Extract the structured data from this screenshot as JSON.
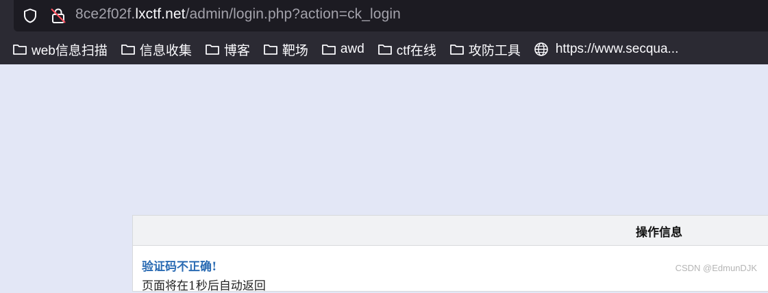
{
  "urlbar": {
    "url_prefix": "8ce2f02f.",
    "url_domain": "lxctf.net",
    "url_path": "/admin/login.php?action=ck_login"
  },
  "bookmarks": [
    {
      "label": "web信息扫描",
      "icon": "folder-icon"
    },
    {
      "label": "信息收集",
      "icon": "folder-icon"
    },
    {
      "label": "博客",
      "icon": "folder-icon"
    },
    {
      "label": "靶场",
      "icon": "folder-icon"
    },
    {
      "label": "awd",
      "icon": "folder-icon"
    },
    {
      "label": "ctf在线",
      "icon": "folder-icon"
    },
    {
      "label": "攻防工具",
      "icon": "folder-icon"
    },
    {
      "label": "https://www.secqua...",
      "icon": "globe-icon"
    }
  ],
  "message": {
    "title": "操作信息",
    "error": "验证码不正确!",
    "redirect": "页面将在1秒后自动返回"
  },
  "watermark": "CSDN @EdmunDJK",
  "colors": {
    "chrome_bg": "#2b2a33",
    "urlbar_bg": "#1c1b22",
    "page_bg": "#e3e7f6",
    "error_text": "#2a6bb3"
  }
}
